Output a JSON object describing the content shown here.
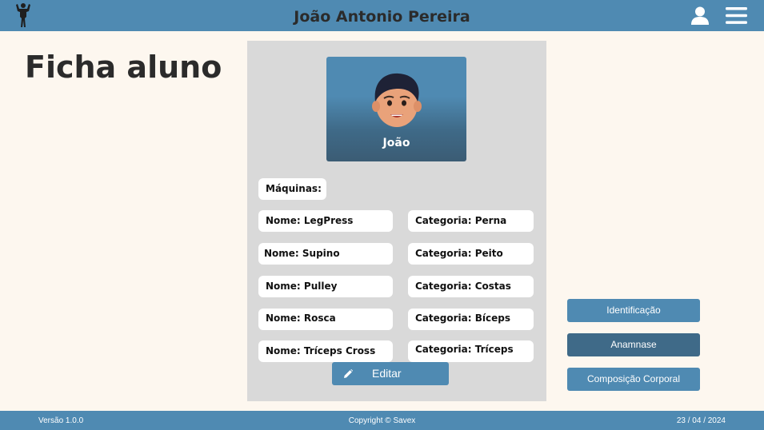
{
  "header": {
    "user_name": "João Antonio Pereira",
    "icons": [
      "bodybuilder-logo-icon",
      "user-icon",
      "menu-icon"
    ]
  },
  "page": {
    "title": "Ficha aluno"
  },
  "profile": {
    "name": "João",
    "avatar": "avatar-icon"
  },
  "machines": {
    "label": "Máquinas:",
    "items": [
      {
        "name": "Nome: LegPress",
        "category": "Categoria: Perna"
      },
      {
        "name": "Nome: Supino",
        "category": "Categoria: Peito"
      },
      {
        "name": "Nome: Pulley",
        "category": "Categoria: Costas"
      },
      {
        "name": "Nome: Rosca",
        "category": "Categoria: Bíceps"
      },
      {
        "name": "Nome: Tríceps Cross",
        "category": "Categoria: Tríceps"
      }
    ]
  },
  "actions": {
    "edit_label": "Editar"
  },
  "side_buttons": [
    "Identificação",
    "Anamnase",
    "Composição Corporal"
  ],
  "footer": {
    "version": "Versão 1.0.0",
    "copyright": "Copyright © Savex",
    "date": "23 / 04 / 2024"
  },
  "colors": {
    "primary": "#4f8ab2",
    "primary_dark": "#3f6a88",
    "background": "#fdf7ef",
    "card": "#d9d9d9"
  }
}
